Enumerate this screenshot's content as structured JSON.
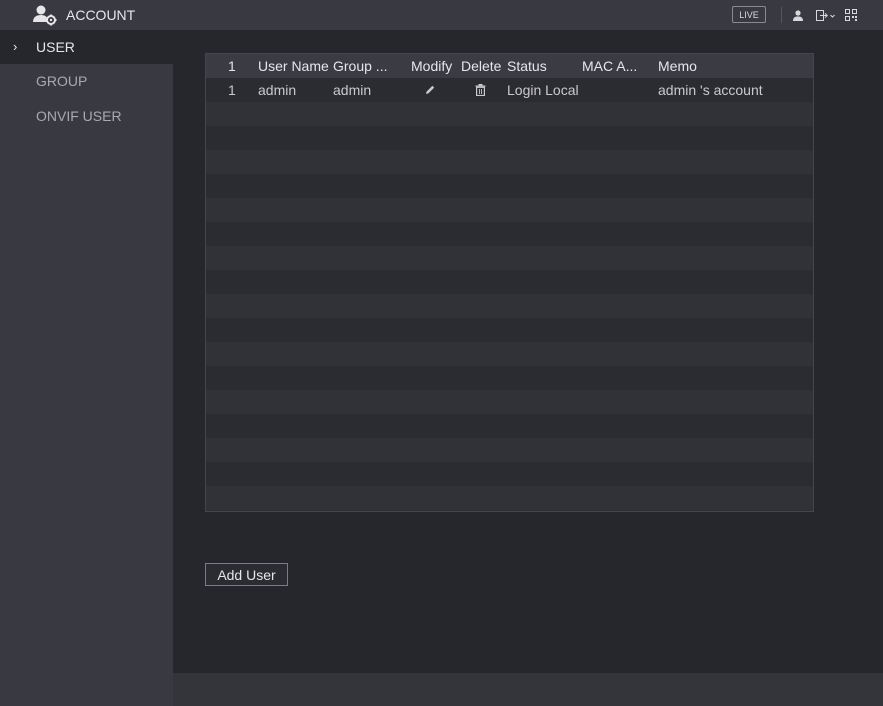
{
  "header": {
    "title": "ACCOUNT",
    "title_icon": "user-gear-icon",
    "live_label": "LIVE",
    "icons": [
      "user-icon",
      "logout-icon",
      "qr-code-icon"
    ]
  },
  "sidebar": {
    "items": [
      {
        "label": "USER",
        "active": true
      },
      {
        "label": "GROUP",
        "active": false
      },
      {
        "label": "ONVIF USER",
        "active": false
      }
    ]
  },
  "table": {
    "columns": [
      "1",
      "User Name",
      "Group ...",
      "Modify",
      "Delete",
      "Status",
      "MAC A...",
      "Memo"
    ],
    "rows": [
      {
        "index": "1",
        "user_name": "admin",
        "group": "admin",
        "modify_icon": "pencil-icon",
        "delete_icon": "trash-icon",
        "status": "Login Local",
        "mac": "",
        "memo": "admin 's account"
      }
    ]
  },
  "actions": {
    "add_user_label": "Add User"
  },
  "colors": {
    "background": "#26262d",
    "panel": "#393941",
    "table_header": "#3b3b43"
  }
}
